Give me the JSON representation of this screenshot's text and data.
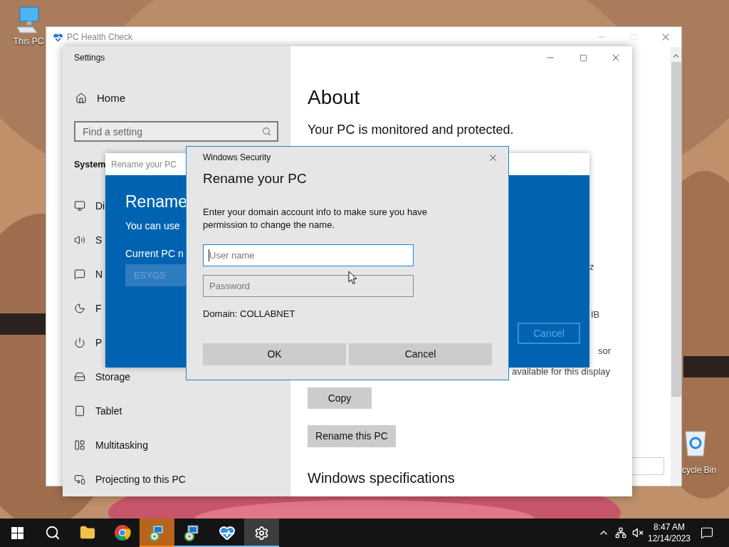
{
  "desktop": {
    "icons": [
      {
        "kind": "computer",
        "label": "This PC"
      },
      {
        "kind": "recycle",
        "label": "cycle Bin"
      }
    ]
  },
  "health_window": {
    "title": "PC Health Check"
  },
  "settings_window": {
    "title": "Settings",
    "home": "Home",
    "search": {
      "placeholder": "Find a setting"
    },
    "section": "System",
    "nav": [
      {
        "kind": "display",
        "label": "Di"
      },
      {
        "kind": "sound",
        "label": "S"
      },
      {
        "kind": "notifications",
        "label": "N"
      },
      {
        "kind": "focus",
        "label": "F"
      },
      {
        "kind": "power",
        "label": "P"
      },
      {
        "kind": "storage",
        "label": "Storage"
      },
      {
        "kind": "tablet",
        "label": "Tablet"
      },
      {
        "kind": "multitasking",
        "label": "Multitasking"
      },
      {
        "kind": "projecting",
        "label": "Projecting to this PC"
      }
    ],
    "about": {
      "heading": "About",
      "status": "Your PC is monitored and protected.",
      "fragments": [
        "z",
        "IB",
        "sor",
        "available for this display"
      ],
      "copy": "Copy",
      "rename": "Rename this PC",
      "specs": "Windows specifications"
    }
  },
  "rename_dialog": {
    "title": "Rename your PC",
    "heading": "Rename",
    "text": "You can use",
    "label": "Current PC n",
    "value": "ESYGS",
    "cancel": "Cancel"
  },
  "security_dialog": {
    "title": "Windows Security",
    "heading": "Rename your PC",
    "text": "Enter your domain account info to make sure you have permission to change the name.",
    "fields": [
      {
        "placeholder": "User name",
        "focused": true
      },
      {
        "placeholder": "Password",
        "focused": false
      }
    ],
    "domain": "Domain: COLLABNET",
    "ok": "OK",
    "cancel": "Cancel"
  },
  "taskbar": {
    "apps": [
      {
        "kind": "start",
        "running": false,
        "selected": false,
        "flashing": false
      },
      {
        "kind": "search",
        "running": false,
        "selected": false,
        "flashing": false
      },
      {
        "kind": "explorer",
        "running": false,
        "selected": false,
        "flashing": false
      },
      {
        "kind": "chrome",
        "running": false,
        "selected": false,
        "flashing": false
      },
      {
        "kind": "setup",
        "running": true,
        "selected": false,
        "flashing": true
      },
      {
        "kind": "setup",
        "running": true,
        "selected": false,
        "flashing": false
      },
      {
        "kind": "health",
        "running": true,
        "selected": false,
        "flashing": false
      },
      {
        "kind": "settings",
        "running": true,
        "selected": true,
        "flashing": false
      }
    ],
    "time": "8:47 AM",
    "date": "12/14/2023"
  }
}
